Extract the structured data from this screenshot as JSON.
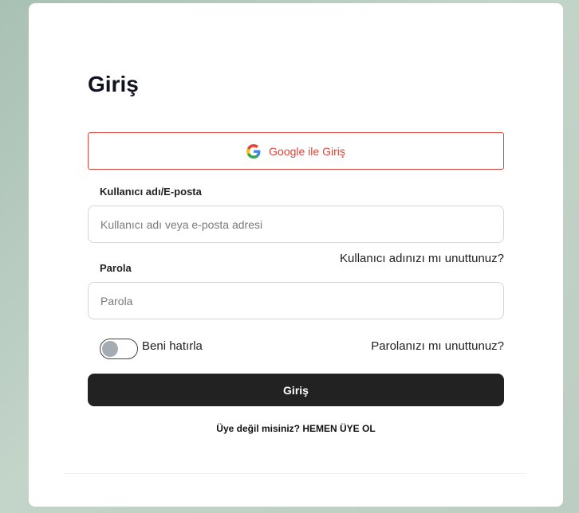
{
  "login": {
    "title": "Giriş",
    "google_button": "Google ile Giriş",
    "google_icon": "google-g-icon",
    "username": {
      "label": "Kullanıcı adı/E-posta",
      "placeholder": "Kullanıcı adı veya e-posta adresi"
    },
    "forgot_username": "Kullanıcı adınızı mı unuttunuz?",
    "password": {
      "label": "Parola",
      "placeholder": "Parola"
    },
    "remember_me": "Beni hatırla",
    "remember_me_on": false,
    "forgot_password": "Parolanızı mı unuttunuz?",
    "submit": "Giriş",
    "not_member": "Üye değil misiniz?",
    "signup_link": "HEMEN ÜYE OL"
  },
  "colors": {
    "google_red": "#d9453a",
    "submit_bg": "#222222",
    "page_bg": "#b5c9bd"
  }
}
